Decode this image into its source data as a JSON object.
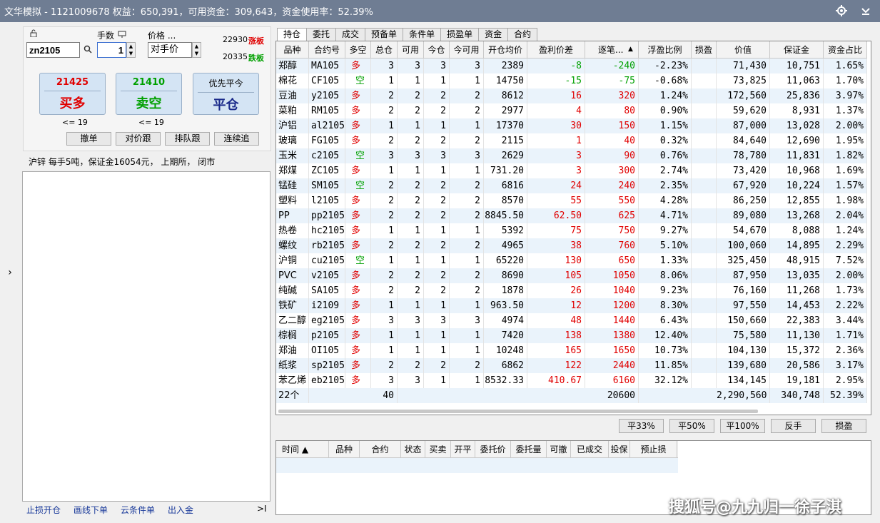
{
  "title": "文华模拟 - 1121009678  权益：650,391，可用资金：309,643，资金使用率：52.39%",
  "order": {
    "contract": "zn2105",
    "lots_label": "手数",
    "lots": "1",
    "price_label": "价格 ...",
    "price_mode": "对手价",
    "limit_up": "22930",
    "limit_up_label": "涨板",
    "limit_down": "20335",
    "limit_down_label": "跌板",
    "buy_price": "21425",
    "buy_label": "买多",
    "sell_price": "21410",
    "sell_label": "卖空",
    "close_top": "优先平今",
    "close_label": "平仓",
    "buy_max": "<= 19",
    "sell_max": "<= 19",
    "cancel": "撤单",
    "price_follow": "对价跟",
    "queue_follow": "排队跟",
    "chase": "连续追",
    "info": "沪锌  每手5吨，保证金16054元，  上期所，  闭市"
  },
  "bottom_links": [
    "止损开仓",
    "画线下单",
    "云条件单",
    "出入金"
  ],
  "tabs": [
    "持仓",
    "委托",
    "成交",
    "预备单",
    "条件单",
    "损盈单",
    "资金",
    "合约"
  ],
  "columns": [
    "品种",
    "合约号",
    "多空",
    "总仓",
    "可用",
    "今仓",
    "今可用",
    "开仓均价",
    "盈利价差",
    "逐笔...",
    "浮盈比例",
    "损盈",
    "价值",
    "保证金",
    "资金占比"
  ],
  "positions": [
    [
      "郑醇",
      "MA105",
      "多",
      "3",
      "3",
      "3",
      "3",
      "2389",
      "-8",
      "-240",
      "-2.23%",
      "",
      "71,430",
      "10,751",
      "1.65%"
    ],
    [
      "棉花",
      "CF105",
      "空",
      "1",
      "1",
      "1",
      "1",
      "14750",
      "-15",
      "-75",
      "-0.68%",
      "",
      "73,825",
      "11,063",
      "1.70%"
    ],
    [
      "豆油",
      "y2105",
      "多",
      "2",
      "2",
      "2",
      "2",
      "8612",
      "16",
      "320",
      "1.24%",
      "",
      "172,560",
      "25,836",
      "3.97%"
    ],
    [
      "菜粕",
      "RM105",
      "多",
      "2",
      "2",
      "2",
      "2",
      "2977",
      "4",
      "80",
      "0.90%",
      "",
      "59,620",
      "8,931",
      "1.37%"
    ],
    [
      "沪铝",
      "al2105",
      "多",
      "1",
      "1",
      "1",
      "1",
      "17370",
      "30",
      "150",
      "1.15%",
      "",
      "87,000",
      "13,028",
      "2.00%"
    ],
    [
      "玻璃",
      "FG105",
      "多",
      "2",
      "2",
      "2",
      "2",
      "2115",
      "1",
      "40",
      "0.32%",
      "",
      "84,640",
      "12,690",
      "1.95%"
    ],
    [
      "玉米",
      "c2105",
      "空",
      "3",
      "3",
      "3",
      "3",
      "2629",
      "3",
      "90",
      "0.76%",
      "",
      "78,780",
      "11,831",
      "1.82%"
    ],
    [
      "郑煤",
      "ZC105",
      "多",
      "1",
      "1",
      "1",
      "1",
      "731.20",
      "3",
      "300",
      "2.74%",
      "",
      "73,420",
      "10,968",
      "1.69%"
    ],
    [
      "锰硅",
      "SM105",
      "空",
      "2",
      "2",
      "2",
      "2",
      "6816",
      "24",
      "240",
      "2.35%",
      "",
      "67,920",
      "10,224",
      "1.57%"
    ],
    [
      "塑料",
      "l2105",
      "多",
      "2",
      "2",
      "2",
      "2",
      "8570",
      "55",
      "550",
      "4.28%",
      "",
      "86,250",
      "12,855",
      "1.98%"
    ],
    [
      "PP",
      "pp2105",
      "多",
      "2",
      "2",
      "2",
      "2",
      "8845.50",
      "62.50",
      "625",
      "4.71%",
      "",
      "89,080",
      "13,268",
      "2.04%"
    ],
    [
      "热卷",
      "hc2105",
      "多",
      "1",
      "1",
      "1",
      "1",
      "5392",
      "75",
      "750",
      "9.27%",
      "",
      "54,670",
      "8,088",
      "1.24%"
    ],
    [
      "螺纹",
      "rb2105",
      "多",
      "2",
      "2",
      "2",
      "2",
      "4965",
      "38",
      "760",
      "5.10%",
      "",
      "100,060",
      "14,895",
      "2.29%"
    ],
    [
      "沪铜",
      "cu2105",
      "空",
      "1",
      "1",
      "1",
      "1",
      "65220",
      "130",
      "650",
      "1.33%",
      "",
      "325,450",
      "48,915",
      "7.52%"
    ],
    [
      "PVC",
      "v2105",
      "多",
      "2",
      "2",
      "2",
      "2",
      "8690",
      "105",
      "1050",
      "8.06%",
      "",
      "87,950",
      "13,035",
      "2.00%"
    ],
    [
      "纯碱",
      "SA105",
      "多",
      "2",
      "2",
      "2",
      "2",
      "1878",
      "26",
      "1040",
      "9.23%",
      "",
      "76,160",
      "11,268",
      "1.73%"
    ],
    [
      "铁矿",
      "i2109",
      "多",
      "1",
      "1",
      "1",
      "1",
      "963.50",
      "12",
      "1200",
      "8.30%",
      "",
      "97,550",
      "14,453",
      "2.22%"
    ],
    [
      "乙二醇",
      "eg2105",
      "多",
      "3",
      "3",
      "3",
      "3",
      "4974",
      "48",
      "1440",
      "6.43%",
      "",
      "150,660",
      "22,383",
      "3.44%"
    ],
    [
      "棕榈",
      "p2105",
      "多",
      "1",
      "1",
      "1",
      "1",
      "7420",
      "138",
      "1380",
      "12.40%",
      "",
      "75,580",
      "11,130",
      "1.71%"
    ],
    [
      "郑油",
      "OI105",
      "多",
      "1",
      "1",
      "1",
      "1",
      "10248",
      "165",
      "1650",
      "10.73%",
      "",
      "104,130",
      "15,372",
      "2.36%"
    ],
    [
      "纸浆",
      "sp2105",
      "多",
      "2",
      "2",
      "2",
      "2",
      "6862",
      "122",
      "2440",
      "11.85%",
      "",
      "139,680",
      "20,586",
      "3.17%"
    ],
    [
      "苯乙烯",
      "eb2105",
      "多",
      "3",
      "3",
      "1",
      "1",
      "8532.33",
      "410.67",
      "6160",
      "32.12%",
      "",
      "134,145",
      "19,181",
      "2.95%"
    ]
  ],
  "total": {
    "count": "22个",
    "total_pos": "40",
    "pnl": "20600",
    "value": "2,290,560",
    "margin": "340,748",
    "ratio": "52.39%"
  },
  "actions": [
    "平33%",
    "平50%",
    "平100%",
    "反手",
    "损盈"
  ],
  "order_columns": [
    "时间 ▲",
    "品种",
    "合约",
    "状态",
    "买卖",
    "开平",
    "委托价",
    "委托量",
    "可撤",
    "已成交",
    "投保",
    "预止损"
  ],
  "watermark": "搜狐号@九九归一徐子淇"
}
